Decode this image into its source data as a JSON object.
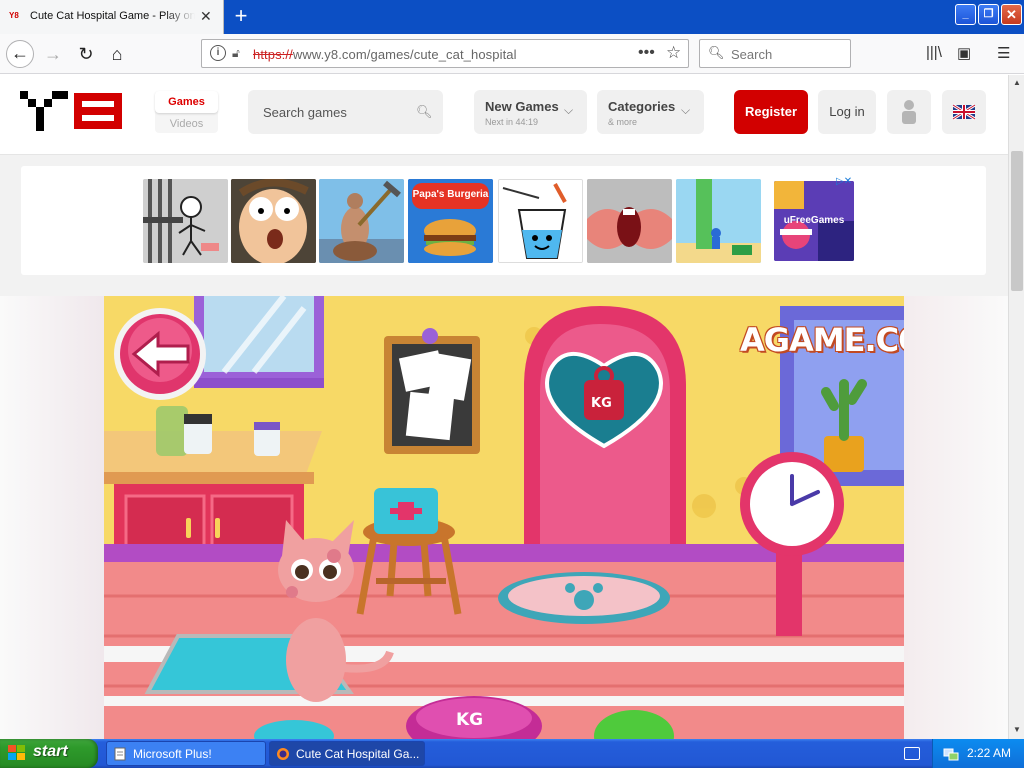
{
  "browser": {
    "tab_title": "Cute Cat Hospital Game - Play online",
    "tab_favicon": "Y8",
    "url_scheme": "https://",
    "url_rest": "www.y8.com/games/cute_cat_hospital",
    "search_placeholder": "Search"
  },
  "site": {
    "nav_games": "Games",
    "nav_videos": "Videos",
    "search_placeholder": "Search games",
    "new_games_label": "New Games",
    "new_games_sub": "Next in 44:19",
    "categories_label": "Categories",
    "categories_sub": "& more",
    "register_label": "Register",
    "login_label": "Log in"
  },
  "ad_thumbnails": [
    {
      "name": "prison-escape",
      "label": ""
    },
    {
      "name": "scared-face",
      "label": ""
    },
    {
      "name": "getting-over-it",
      "label": ""
    },
    {
      "name": "papas-burgeria",
      "label": "Papa's Burgeria"
    },
    {
      "name": "happy-glass",
      "label": ""
    },
    {
      "name": "open-mouth",
      "label": ""
    },
    {
      "name": "tower-run",
      "label": ""
    },
    {
      "name": "ufreegames",
      "label": "uFreeGames"
    }
  ],
  "game": {
    "watermark": "AGAME.COM",
    "scale_label": "KG",
    "button_label": "KG"
  },
  "taskbar": {
    "start_label": "start",
    "items": [
      {
        "label": "Microsoft Plus!"
      },
      {
        "label": "Cute Cat Hospital Ga..."
      }
    ],
    "clock": "2:22 AM"
  },
  "colors": {
    "brand_red": "#d20000",
    "xp_blue": "#245edb",
    "start_green": "#2e9a2b"
  }
}
